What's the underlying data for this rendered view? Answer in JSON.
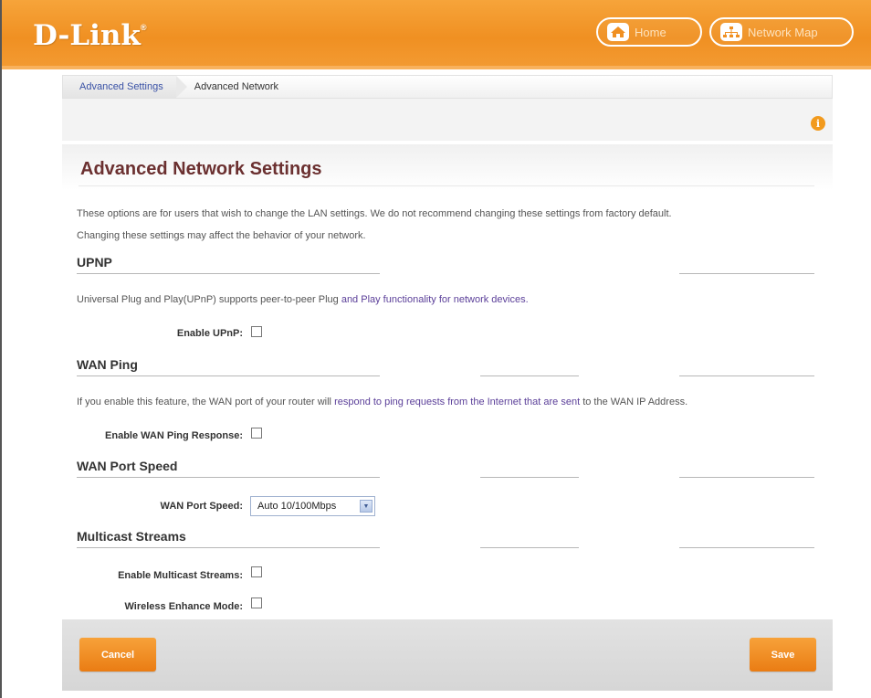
{
  "header": {
    "logo": "D-Link",
    "logo_mark": "®",
    "home_label": "Home",
    "network_map_label": "Network Map"
  },
  "breadcrumb": {
    "parent": "Advanced Settings",
    "current": "Advanced Network"
  },
  "panel": {
    "title": "Advanced Network Settings",
    "description_line1": "These options are for users that wish to change the LAN settings. We do not recommend changing these settings from factory default.",
    "description_line2": "Changing these settings may affect the behavior of your network."
  },
  "upnp": {
    "heading": "UPNP",
    "description_a": "Universal Plug and Play(UPnP) supports peer-to-peer Plug",
    "description_b": " and Play functionality for network devices.",
    "enable_label": "Enable UPnP:",
    "enabled": false
  },
  "wan_ping": {
    "heading": "WAN Ping",
    "description_a": "If you enable this feature, the WAN port of your router will",
    "description_b": " respond to ping requests from the Internet that are sent ",
    "description_c": "to the WAN IP Address.",
    "enable_label": "Enable WAN Ping Response:",
    "enabled": false
  },
  "wan_port_speed": {
    "heading": "WAN Port Speed",
    "label": "WAN Port Speed:",
    "selected": "Auto 10/100Mbps"
  },
  "multicast": {
    "heading": "Multicast Streams",
    "enable_label": "Enable Multicast Streams:",
    "enabled": false,
    "wireless_label": "Wireless Enhance Mode:",
    "wireless_enabled": false
  },
  "footer": {
    "cancel_label": "Cancel",
    "save_label": "Save"
  },
  "colors": {
    "brand_orange": "#f09022",
    "title_color": "#6b3030",
    "link_blue": "#3a52a6"
  }
}
